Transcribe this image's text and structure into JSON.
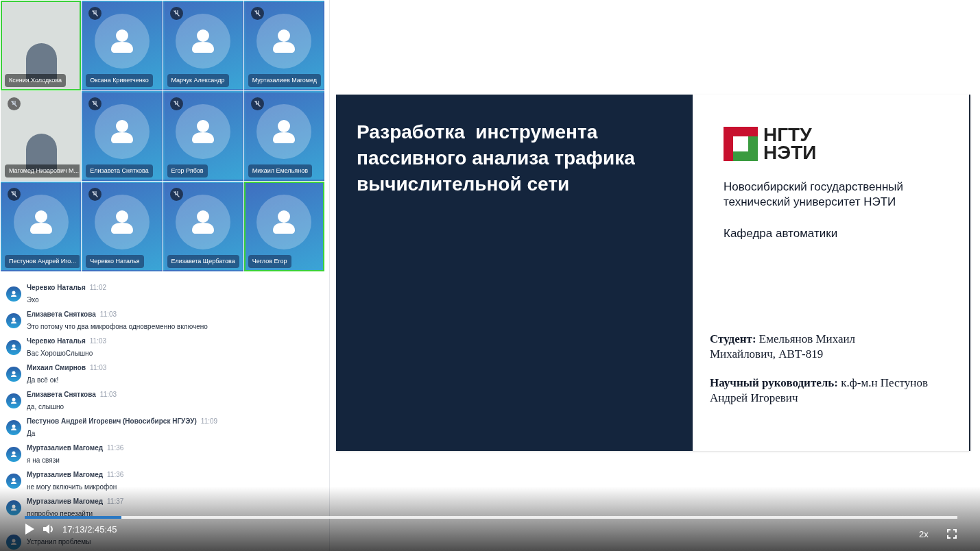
{
  "tiles": [
    {
      "name": "Ксения Холодкова",
      "kind": "video",
      "muted": false,
      "speaking": true
    },
    {
      "name": "Оксана Криветченко",
      "kind": "avatar",
      "muted": true,
      "speaking": false
    },
    {
      "name": "Марчук Александр",
      "kind": "avatar",
      "muted": true,
      "speaking": false
    },
    {
      "name": "Муртазалиев Магомед",
      "kind": "avatar",
      "muted": true,
      "speaking": false
    },
    {
      "name": "Магомед Низарович М...",
      "kind": "video",
      "muted": true,
      "speaking": false
    },
    {
      "name": "Елизавета Сняткова",
      "kind": "avatar",
      "muted": true,
      "speaking": false
    },
    {
      "name": "Егор Рябов",
      "kind": "avatar",
      "muted": true,
      "speaking": false
    },
    {
      "name": "Михаил Емельянов",
      "kind": "avatar",
      "muted": true,
      "speaking": false
    },
    {
      "name": "Пестунов Андрей Иго...",
      "kind": "avatar",
      "muted": true,
      "speaking": false
    },
    {
      "name": "Черевко Наталья",
      "kind": "avatar",
      "muted": true,
      "speaking": false
    },
    {
      "name": "Елизавета Щербатова",
      "kind": "avatar",
      "muted": true,
      "speaking": false
    },
    {
      "name": "Чеглов Егор",
      "kind": "avatar",
      "muted": false,
      "speaking": true
    }
  ],
  "chat": [
    {
      "author": "Черевко Наталья",
      "time": "11:02",
      "text": "Эхо"
    },
    {
      "author": "Елизавета Сняткова",
      "time": "11:03",
      "text": "Это потому что два микрофона одновременно включено"
    },
    {
      "author": "Черевко Наталья",
      "time": "11:03",
      "text": "Вас ХорошоСлышно"
    },
    {
      "author": "Михаил Смирнов",
      "time": "11:03",
      "text": "Да всё ок!"
    },
    {
      "author": "Елизавета Сняткова",
      "time": "11:03",
      "text": "да, слышно"
    },
    {
      "author": "Пестунов Андрей Игоревич (Новосибирск НГУЭУ)",
      "time": "11:09",
      "text": "Да"
    },
    {
      "author": "Муртазалиев Магомед",
      "time": "11:36",
      "text": "я на связи"
    },
    {
      "author": "Муртазалиев Магомед",
      "time": "11:36",
      "text": "не могу включить микрофон"
    },
    {
      "author": "Муртазалиев Магомед",
      "time": "11:37",
      "text": "попробую перезайти"
    },
    {
      "text": "Устранил проблемы"
    }
  ],
  "slide": {
    "title": "Разработка  инструмента пассивного анализа трафика вычислительной сети",
    "logo_lines": [
      "НГТУ",
      "НЭТИ"
    ],
    "university": "Новосибирский государственный технический университет НЭТИ",
    "department": "Кафедра автоматики",
    "student": "**Студент:** Емельянов Михаил Михайлович, АВТ-819",
    "supervisor": "**Научный руководитель:** к.ф-м.н Пестунов Андрей Игоревич"
  },
  "player": {
    "playing": false,
    "level": 0.104,
    "time": "17:13/2:45:45",
    "speed": "2x"
  }
}
